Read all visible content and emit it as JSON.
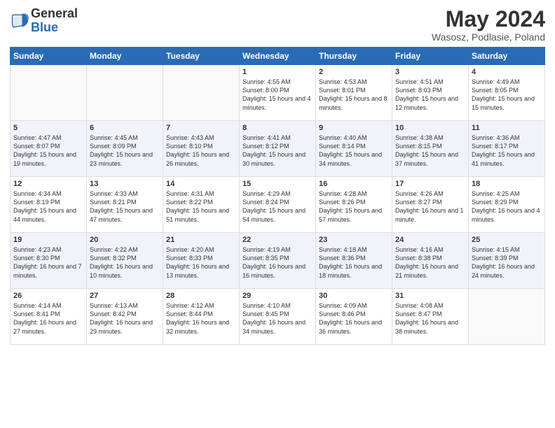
{
  "header": {
    "logo_general": "General",
    "logo_blue": "Blue",
    "title": "May 2024",
    "subtitle": "Wasosz, Podlasie, Poland"
  },
  "days_of_week": [
    "Sunday",
    "Monday",
    "Tuesday",
    "Wednesday",
    "Thursday",
    "Friday",
    "Saturday"
  ],
  "weeks": [
    [
      {
        "day": "",
        "info": ""
      },
      {
        "day": "",
        "info": ""
      },
      {
        "day": "",
        "info": ""
      },
      {
        "day": "1",
        "info": "Sunrise: 4:55 AM\nSunset: 8:00 PM\nDaylight: 15 hours\nand 4 minutes."
      },
      {
        "day": "2",
        "info": "Sunrise: 4:53 AM\nSunset: 8:01 PM\nDaylight: 15 hours\nand 8 minutes."
      },
      {
        "day": "3",
        "info": "Sunrise: 4:51 AM\nSunset: 8:03 PM\nDaylight: 15 hours\nand 12 minutes."
      },
      {
        "day": "4",
        "info": "Sunrise: 4:49 AM\nSunset: 8:05 PM\nDaylight: 15 hours\nand 15 minutes."
      }
    ],
    [
      {
        "day": "5",
        "info": "Sunrise: 4:47 AM\nSunset: 8:07 PM\nDaylight: 15 hours\nand 19 minutes."
      },
      {
        "day": "6",
        "info": "Sunrise: 4:45 AM\nSunset: 8:09 PM\nDaylight: 15 hours\nand 23 minutes."
      },
      {
        "day": "7",
        "info": "Sunrise: 4:43 AM\nSunset: 8:10 PM\nDaylight: 15 hours\nand 26 minutes."
      },
      {
        "day": "8",
        "info": "Sunrise: 4:41 AM\nSunset: 8:12 PM\nDaylight: 15 hours\nand 30 minutes."
      },
      {
        "day": "9",
        "info": "Sunrise: 4:40 AM\nSunset: 8:14 PM\nDaylight: 15 hours\nand 34 minutes."
      },
      {
        "day": "10",
        "info": "Sunrise: 4:38 AM\nSunset: 8:15 PM\nDaylight: 15 hours\nand 37 minutes."
      },
      {
        "day": "11",
        "info": "Sunrise: 4:36 AM\nSunset: 8:17 PM\nDaylight: 15 hours\nand 41 minutes."
      }
    ],
    [
      {
        "day": "12",
        "info": "Sunrise: 4:34 AM\nSunset: 8:19 PM\nDaylight: 15 hours\nand 44 minutes."
      },
      {
        "day": "13",
        "info": "Sunrise: 4:33 AM\nSunset: 8:21 PM\nDaylight: 15 hours\nand 47 minutes."
      },
      {
        "day": "14",
        "info": "Sunrise: 4:31 AM\nSunset: 8:22 PM\nDaylight: 15 hours\nand 51 minutes."
      },
      {
        "day": "15",
        "info": "Sunrise: 4:29 AM\nSunset: 8:24 PM\nDaylight: 15 hours\nand 54 minutes."
      },
      {
        "day": "16",
        "info": "Sunrise: 4:28 AM\nSunset: 8:26 PM\nDaylight: 15 hours\nand 57 minutes."
      },
      {
        "day": "17",
        "info": "Sunrise: 4:26 AM\nSunset: 8:27 PM\nDaylight: 16 hours\nand 1 minute."
      },
      {
        "day": "18",
        "info": "Sunrise: 4:25 AM\nSunset: 8:29 PM\nDaylight: 16 hours\nand 4 minutes."
      }
    ],
    [
      {
        "day": "19",
        "info": "Sunrise: 4:23 AM\nSunset: 8:30 PM\nDaylight: 16 hours\nand 7 minutes."
      },
      {
        "day": "20",
        "info": "Sunrise: 4:22 AM\nSunset: 8:32 PM\nDaylight: 16 hours\nand 10 minutes."
      },
      {
        "day": "21",
        "info": "Sunrise: 4:20 AM\nSunset: 8:33 PM\nDaylight: 16 hours\nand 13 minutes."
      },
      {
        "day": "22",
        "info": "Sunrise: 4:19 AM\nSunset: 8:35 PM\nDaylight: 16 hours\nand 16 minutes."
      },
      {
        "day": "23",
        "info": "Sunrise: 4:18 AM\nSunset: 8:36 PM\nDaylight: 16 hours\nand 18 minutes."
      },
      {
        "day": "24",
        "info": "Sunrise: 4:16 AM\nSunset: 8:38 PM\nDaylight: 16 hours\nand 21 minutes."
      },
      {
        "day": "25",
        "info": "Sunrise: 4:15 AM\nSunset: 8:39 PM\nDaylight: 16 hours\nand 24 minutes."
      }
    ],
    [
      {
        "day": "26",
        "info": "Sunrise: 4:14 AM\nSunset: 8:41 PM\nDaylight: 16 hours\nand 27 minutes."
      },
      {
        "day": "27",
        "info": "Sunrise: 4:13 AM\nSunset: 8:42 PM\nDaylight: 16 hours\nand 29 minutes."
      },
      {
        "day": "28",
        "info": "Sunrise: 4:12 AM\nSunset: 8:44 PM\nDaylight: 16 hours\nand 32 minutes."
      },
      {
        "day": "29",
        "info": "Sunrise: 4:10 AM\nSunset: 8:45 PM\nDaylight: 16 hours\nand 34 minutes."
      },
      {
        "day": "30",
        "info": "Sunrise: 4:09 AM\nSunset: 8:46 PM\nDaylight: 16 hours\nand 36 minutes."
      },
      {
        "day": "31",
        "info": "Sunrise: 4:08 AM\nSunset: 8:47 PM\nDaylight: 16 hours\nand 38 minutes."
      },
      {
        "day": "",
        "info": ""
      }
    ]
  ]
}
